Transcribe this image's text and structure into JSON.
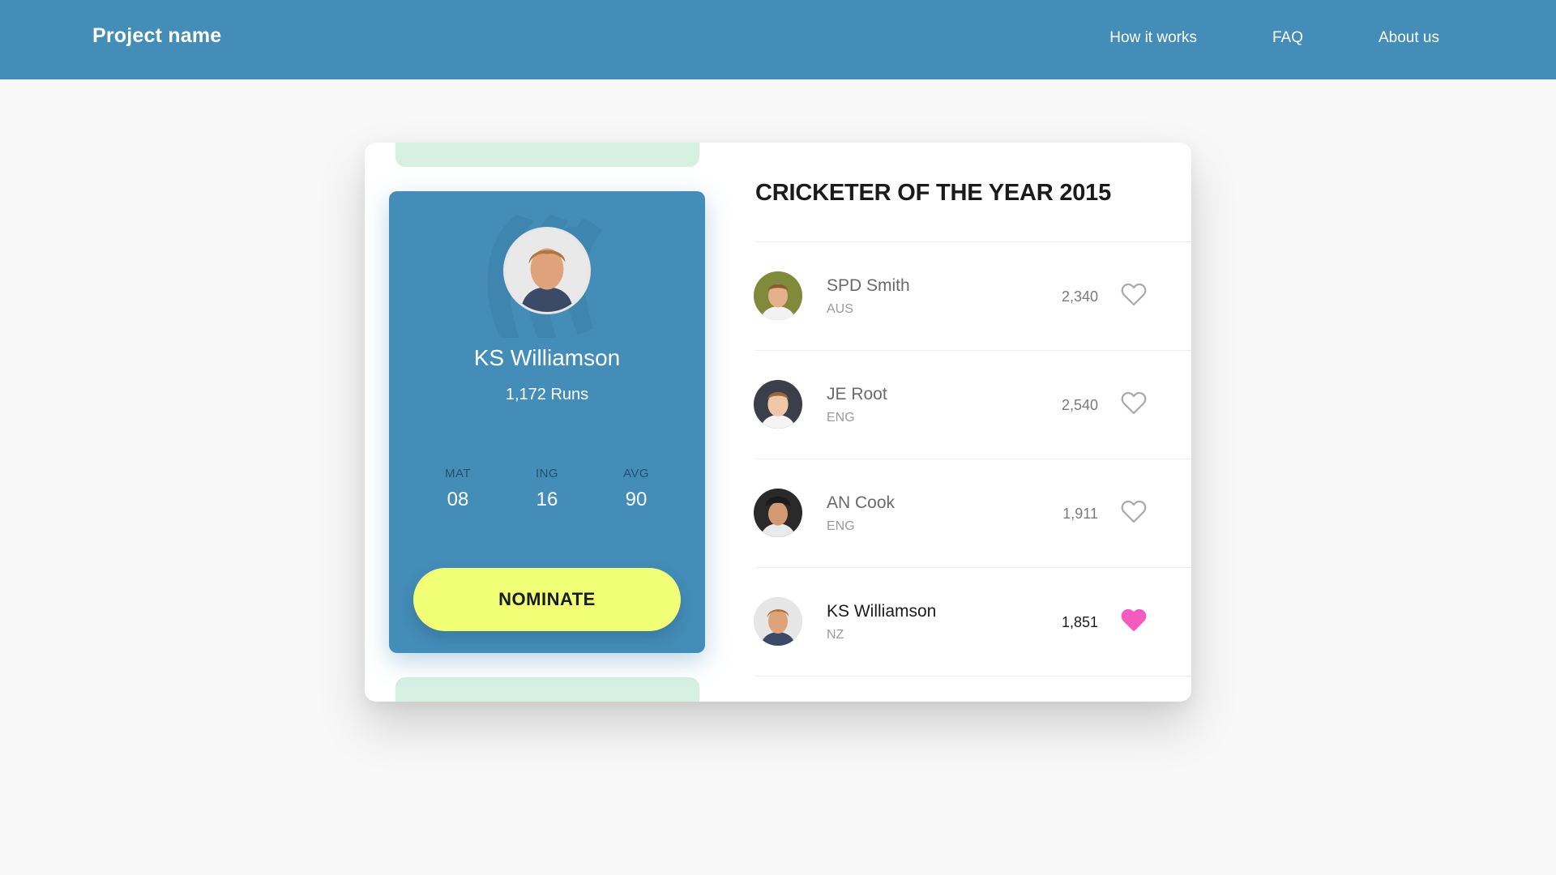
{
  "nav": {
    "brand": "Project name",
    "links": [
      "How it works",
      "FAQ",
      "About us"
    ]
  },
  "card": {
    "name": "KS Williamson",
    "runs": "1,172 Runs",
    "stats": [
      {
        "label": "MAT",
        "value": "08"
      },
      {
        "label": "ING",
        "value": "16"
      },
      {
        "label": "AVG",
        "value": "90"
      }
    ],
    "nominate_label": "NOMINATE"
  },
  "list": {
    "title": "CRICKETER OF THE YEAR 2015",
    "players": [
      {
        "name": "SPD Smith",
        "country": "AUS",
        "votes": "2,340",
        "liked": false
      },
      {
        "name": "JE Root",
        "country": "ENG",
        "votes": "2,540",
        "liked": false
      },
      {
        "name": "AN Cook",
        "country": "ENG",
        "votes": "1,911",
        "liked": false
      },
      {
        "name": "KS Williamson",
        "country": "NZ",
        "votes": "1,851",
        "liked": true
      }
    ]
  },
  "colors": {
    "primary": "#448db9",
    "accent_yellow": "#f0ff76",
    "heart_active": "#f45bbf",
    "heart_inactive": "#a9a9a9",
    "stub_green": "#d6f0e2"
  },
  "icons": {
    "heart": "heart-icon",
    "watermark": "cricket-logo-icon"
  }
}
